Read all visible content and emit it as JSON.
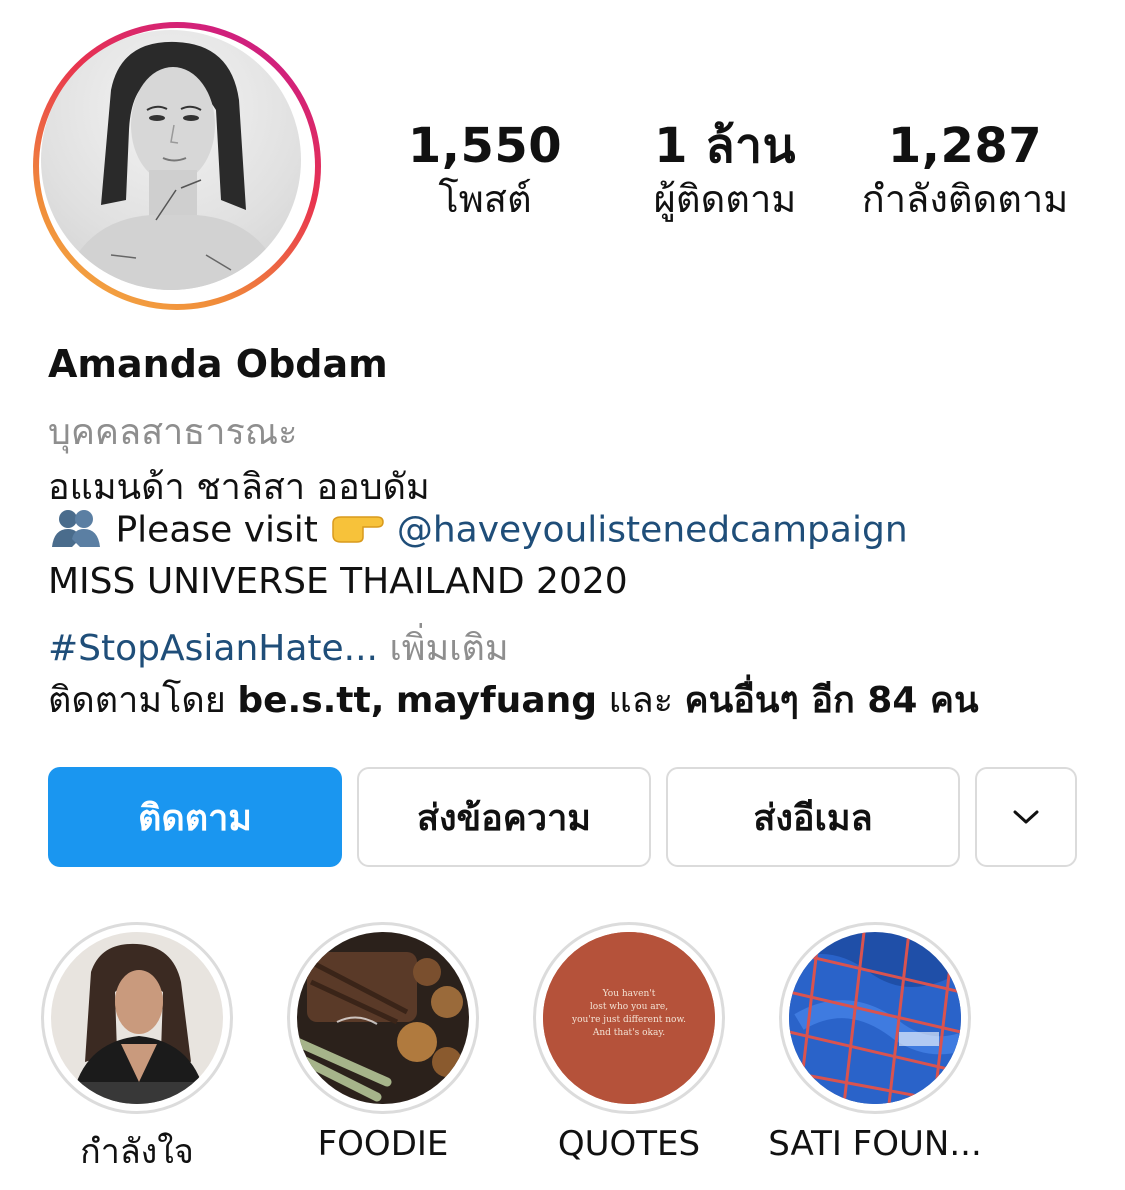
{
  "profile": {
    "stats": {
      "posts": {
        "value": "1,550",
        "label": "โพสต์"
      },
      "followers": {
        "value": "1 ล้าน",
        "label": "ผู้ติดตาม"
      },
      "following": {
        "value": "1,287",
        "label": "กำลังติดตาม"
      }
    },
    "name": "Amanda Obdam",
    "category": "บุคคลสาธารณะ",
    "full_name": "อแมนด้า ชาลิสา ออบดัม",
    "bio_line1_text": "Please visit",
    "bio_line1_mention": "@haveyoulistenedcampaign",
    "bio_line2": "MISS UNIVERSE THAILAND 2020",
    "bio_line3_hashtag": "#StopAsianHate...",
    "bio_more": "เพิ่มเติม",
    "followed_by": {
      "prefix": "ติดตามโดย",
      "user1": "be.s.tt,",
      "user2": "mayfuang",
      "and": "และ",
      "others": "คนอื่นๆ อีก 84 คน"
    }
  },
  "actions": {
    "follow": "ติดตาม",
    "message": "ส่งข้อความ",
    "email": "ส่งอีเมล"
  },
  "highlights": [
    {
      "label": "กำลังใจ"
    },
    {
      "label": "FOODIE"
    },
    {
      "label": "QUOTES",
      "quote": [
        "You haven't",
        "lost who you are,",
        "you're just different now.",
        "And that's okay."
      ]
    },
    {
      "label": "SATI FOUN..."
    }
  ],
  "colors": {
    "follow_button": "#1a96f0",
    "link_blue": "#1f4e79",
    "secondary_text": "#8e8e8e",
    "quotes_bg": "#b5523a"
  }
}
